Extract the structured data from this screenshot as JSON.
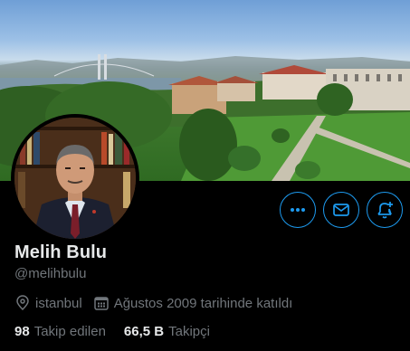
{
  "profile": {
    "name": "Melih Bulu",
    "handle": "@melihbulu",
    "location": "istanbul",
    "joined": "Ağustos 2009 tarihinde katıldı"
  },
  "stats": {
    "following_count": "98",
    "following_label": "Takip edilen",
    "followers_count": "66,5 B",
    "followers_label": "Takipçi"
  },
  "icons": {
    "more": "more-icon",
    "message": "mail-icon",
    "notify": "bell-plus-icon",
    "location": "location-pin-icon",
    "calendar": "calendar-icon"
  },
  "colors": {
    "accent": "#1d9bf0",
    "background": "#000000",
    "primary_text": "#e7e9ea",
    "secondary_text": "#71767b"
  }
}
